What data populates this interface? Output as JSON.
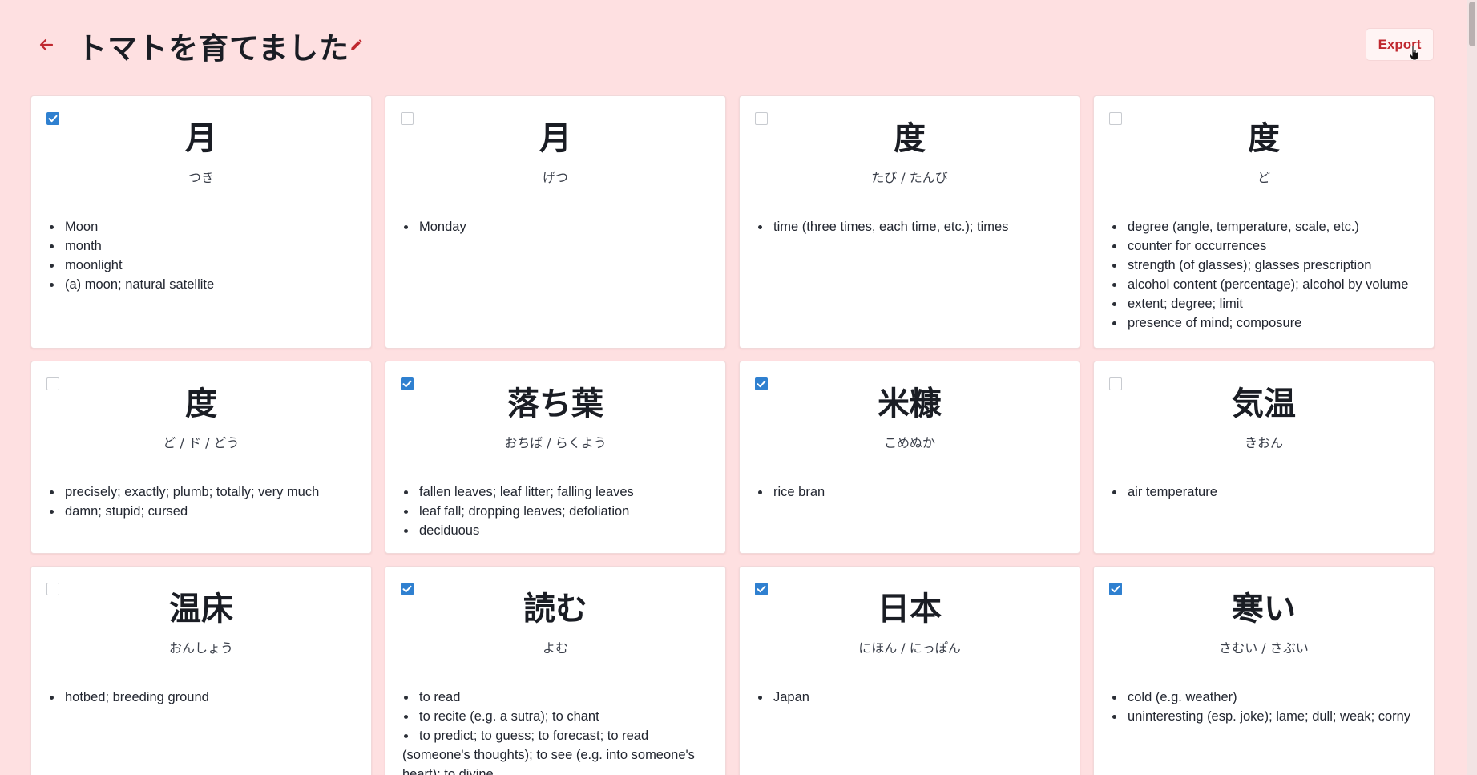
{
  "header": {
    "title": "トマトを育てました",
    "export_label": "Export",
    "back_icon": "arrow-left-icon",
    "edit_icon": "pencil-icon"
  },
  "colors": {
    "background": "#fee0e1",
    "accent": "#c0282f",
    "checkbox": "#2f80d0"
  },
  "cards": [
    {
      "word": "月",
      "reading": "つき",
      "checked": true,
      "meanings": [
        "Moon",
        "month",
        "moonlight",
        "(a) moon; natural satellite"
      ]
    },
    {
      "word": "月",
      "reading": "げつ",
      "checked": false,
      "meanings": [
        "Monday"
      ]
    },
    {
      "word": "度",
      "reading": "たび / たんび",
      "checked": false,
      "meanings": [
        "time (three times, each time, etc.); times"
      ]
    },
    {
      "word": "度",
      "reading": "ど",
      "checked": false,
      "meanings": [
        "degree (angle, temperature, scale, etc.)",
        "counter for occurrences",
        "strength (of glasses); glasses prescription",
        "alcohol content (percentage); alcohol by volume",
        "extent; degree; limit",
        "presence of mind; composure"
      ]
    },
    {
      "word": "度",
      "reading": "ど / ド / どう",
      "checked": false,
      "meanings": [
        "precisely; exactly; plumb; totally; very much",
        "damn; stupid; cursed"
      ]
    },
    {
      "word": "落ち葉",
      "reading": "おちば / らくよう",
      "checked": true,
      "meanings": [
        "fallen leaves; leaf litter; falling leaves",
        "leaf fall; dropping leaves; defoliation",
        "deciduous"
      ]
    },
    {
      "word": "米糠",
      "reading": "こめぬか",
      "checked": true,
      "meanings": [
        "rice bran"
      ]
    },
    {
      "word": "気温",
      "reading": "きおん",
      "checked": false,
      "meanings": [
        "air temperature"
      ]
    },
    {
      "word": "温床",
      "reading": "おんしょう",
      "checked": false,
      "meanings": [
        "hotbed; breeding ground"
      ]
    },
    {
      "word": "読む",
      "reading": "よむ",
      "checked": true,
      "meanings": [
        "to read",
        "to recite (e.g. a sutra); to chant",
        "to predict; to guess; to forecast; to read (someone's thoughts); to see (e.g. into someone's heart); to divine"
      ]
    },
    {
      "word": "日本",
      "reading": "にほん / にっぽん",
      "checked": true,
      "meanings": [
        "Japan"
      ]
    },
    {
      "word": "寒い",
      "reading": "さむい / さぶい",
      "checked": true,
      "meanings": [
        "cold (e.g. weather)",
        "uninteresting (esp. joke); lame; dull; weak; corny"
      ]
    }
  ]
}
